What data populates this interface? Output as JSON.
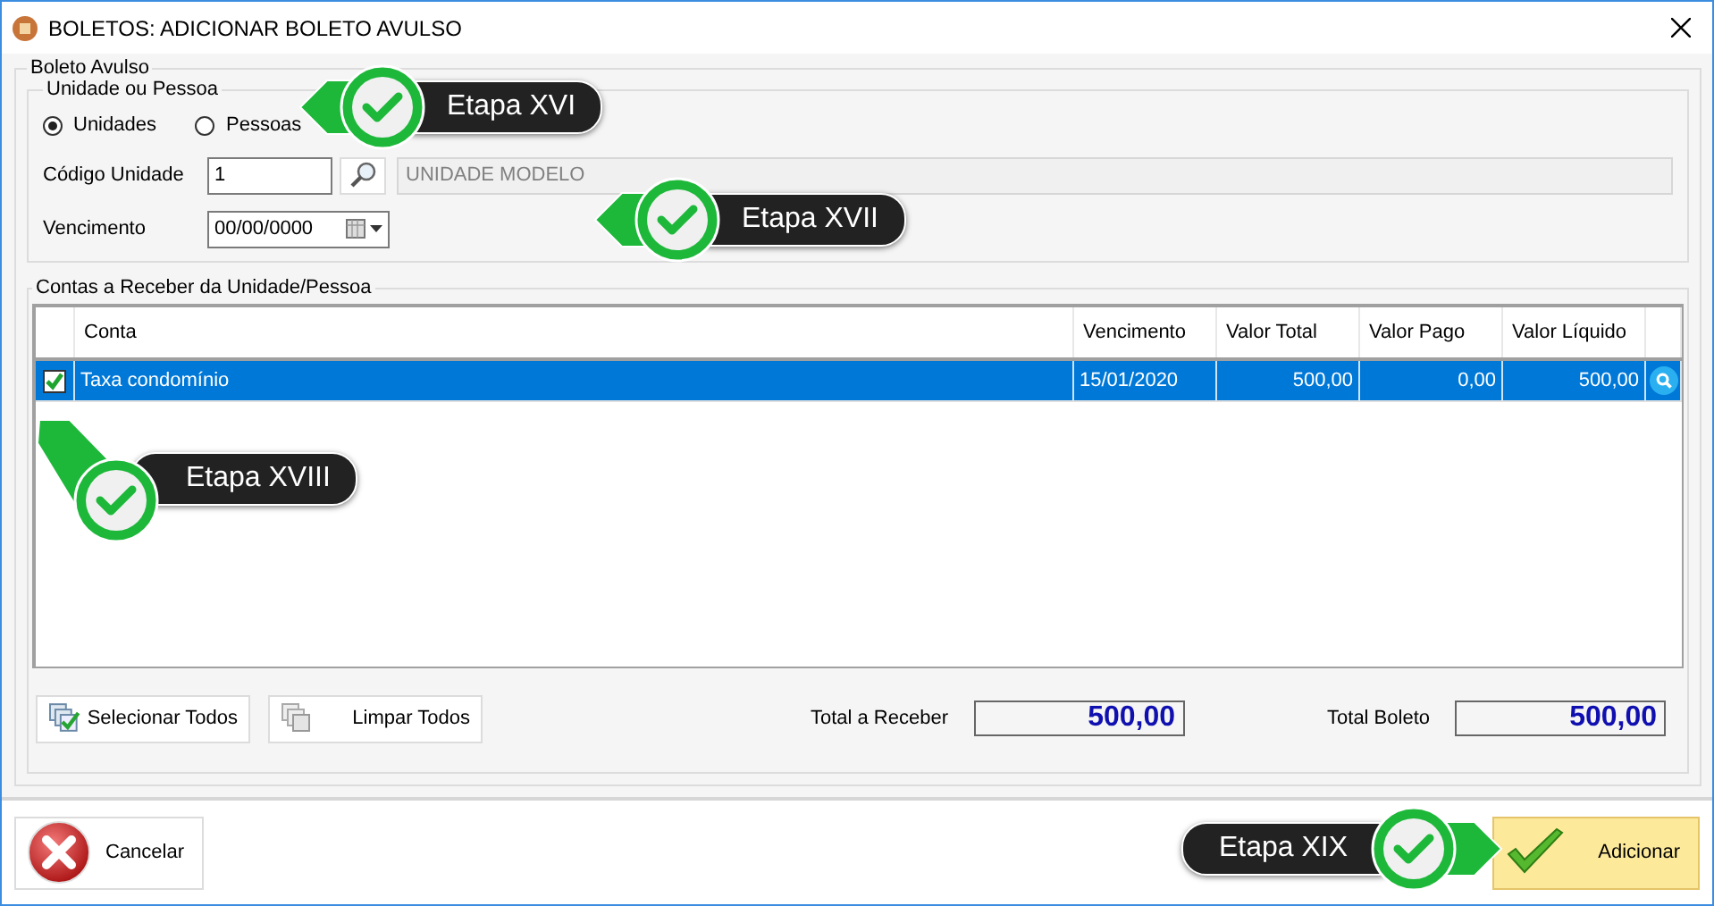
{
  "window": {
    "title": "BOLETOS: ADICIONAR BOLETO AVULSO"
  },
  "group": {
    "title": "Boleto Avulso"
  },
  "selector": {
    "title": "Unidade ou Pessoa",
    "options": [
      {
        "label": "Unidades",
        "selected": true
      },
      {
        "label": "Pessoas",
        "selected": false
      }
    ],
    "code_label": "Código Unidade",
    "code_value": "1",
    "name_value": "UNIDADE MODELO",
    "due_label": "Vencimento",
    "due_value": "00/00/0000"
  },
  "receivables": {
    "title": "Contas a Receber da Unidade/Pessoa",
    "columns": [
      "Conta",
      "Vencimento",
      "Valor Total",
      "Valor Pago",
      "Valor Líquido"
    ],
    "rows": [
      {
        "checked": true,
        "selected": true,
        "cells": [
          "Taxa condomínio",
          "15/01/2020",
          "500,00",
          "0,00",
          "500,00"
        ]
      }
    ]
  },
  "actions": [
    {
      "kind": "select",
      "label": "Selecionar Todos"
    },
    {
      "kind": "clear",
      "label": "Limpar Todos"
    }
  ],
  "totals": [
    {
      "label": "Total a Receber",
      "value": "500,00"
    },
    {
      "label": "Total Boleto",
      "value": "500,00"
    }
  ],
  "footer": {
    "cancel": "Cancelar",
    "add": "Adicionar"
  },
  "callouts": [
    {
      "label": "Etapa XVI"
    },
    {
      "label": "Etapa XVII"
    },
    {
      "label": "Etapa XVIII"
    },
    {
      "label": "Etapa XIX"
    }
  ]
}
